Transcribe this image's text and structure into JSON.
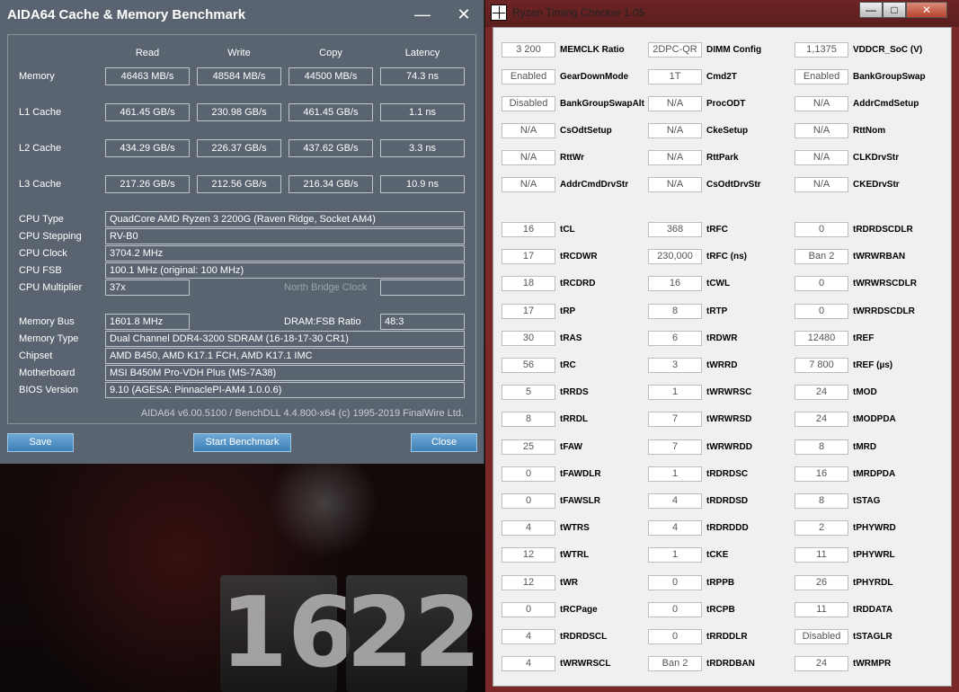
{
  "aida": {
    "title": "AIDA64 Cache & Memory Benchmark",
    "headers": [
      "Read",
      "Write",
      "Copy",
      "Latency"
    ],
    "rows": [
      {
        "label": "Memory",
        "values": [
          "46463 MB/s",
          "48584 MB/s",
          "44500 MB/s",
          "74.3 ns"
        ]
      },
      {
        "label": "L1 Cache",
        "values": [
          "461.45 GB/s",
          "230.98 GB/s",
          "461.45 GB/s",
          "1.1 ns"
        ]
      },
      {
        "label": "L2 Cache",
        "values": [
          "434.29 GB/s",
          "226.37 GB/s",
          "437.62 GB/s",
          "3.3 ns"
        ]
      },
      {
        "label": "L3 Cache",
        "values": [
          "217.26 GB/s",
          "212.56 GB/s",
          "216.34 GB/s",
          "10.9 ns"
        ]
      }
    ],
    "cpu_info": [
      {
        "label": "CPU Type",
        "value": "QuadCore AMD Ryzen 3 2200G  (Raven Ridge, Socket AM4)"
      },
      {
        "label": "CPU Stepping",
        "value": "RV-B0"
      },
      {
        "label": "CPU Clock",
        "value": "3704.2 MHz"
      },
      {
        "label": "CPU FSB",
        "value": "100.1 MHz  (original: 100 MHz)"
      }
    ],
    "cpu_multiplier": {
      "label": "CPU Multiplier",
      "value": "37x",
      "nb_label": "North Bridge Clock",
      "nb_value": ""
    },
    "memory_bus": {
      "label": "Memory Bus",
      "value": "1601.8 MHz",
      "ratio_label": "DRAM:FSB Ratio",
      "ratio_value": "48:3"
    },
    "sys_info": [
      {
        "label": "Memory Type",
        "value": "Dual Channel DDR4-3200 SDRAM  (16-18-17-30 CR1)"
      },
      {
        "label": "Chipset",
        "value": "AMD B450, AMD K17.1 FCH, AMD K17.1 IMC"
      },
      {
        "label": "Motherboard",
        "value": "MSI B450M Pro-VDH Plus (MS-7A38)"
      },
      {
        "label": "BIOS Version",
        "value": "9.10  (AGESA: PinnaclePI-AM4 1.0.0.6)"
      }
    ],
    "footer": "AIDA64 v6.00.5100 / BenchDLL 4.4.800-x64  (c) 1995-2019 FinalWire Ltd.",
    "buttons": {
      "save": "Save",
      "start": "Start Benchmark",
      "close": "Close"
    },
    "minimize_glyph": "—",
    "close_glyph": "✕"
  },
  "rtc": {
    "title": "Ryzen Timing Checker 1.05",
    "window_buttons": {
      "minimize": "—",
      "maximize": "□",
      "close": "✕"
    },
    "config": [
      [
        {
          "v": "3 200",
          "l": "MEMCLK Ratio"
        },
        {
          "v": "2DPC-QR",
          "l": "DIMM Config"
        },
        {
          "v": "1,1375",
          "l": "VDDCR_SoC (V)"
        }
      ],
      [
        {
          "v": "Enabled",
          "l": "GearDownMode"
        },
        {
          "v": "1T",
          "l": "Cmd2T"
        },
        {
          "v": "Enabled",
          "l": "BankGroupSwap"
        }
      ],
      [
        {
          "v": "Disabled",
          "l": "BankGroupSwapAlt"
        },
        {
          "v": "N/A",
          "l": "ProcODT"
        },
        {
          "v": "N/A",
          "l": "AddrCmdSetup"
        }
      ],
      [
        {
          "v": "N/A",
          "l": "CsOdtSetup"
        },
        {
          "v": "N/A",
          "l": "CkeSetup"
        },
        {
          "v": "N/A",
          "l": "RttNom"
        }
      ],
      [
        {
          "v": "N/A",
          "l": "RttWr"
        },
        {
          "v": "N/A",
          "l": "RttPark"
        },
        {
          "v": "N/A",
          "l": "CLKDrvStr"
        }
      ],
      [
        {
          "v": "N/A",
          "l": "AddrCmdDrvStr"
        },
        {
          "v": "N/A",
          "l": "CsOdtDrvStr"
        },
        {
          "v": "N/A",
          "l": "CKEDrvStr"
        }
      ]
    ],
    "timings": [
      [
        {
          "v": "16",
          "l": "tCL"
        },
        {
          "v": "368",
          "l": "tRFC"
        },
        {
          "v": "0",
          "l": "tRDRDSCDLR"
        }
      ],
      [
        {
          "v": "17",
          "l": "tRCDWR"
        },
        {
          "v": "230,000",
          "l": "tRFC (ns)"
        },
        {
          "v": "Ban 2",
          "l": "tWRWRBAN"
        }
      ],
      [
        {
          "v": "18",
          "l": "tRCDRD"
        },
        {
          "v": "16",
          "l": "tCWL"
        },
        {
          "v": "0",
          "l": "tWRWRSCDLR"
        }
      ],
      [
        {
          "v": "17",
          "l": "tRP"
        },
        {
          "v": "8",
          "l": "tRTP"
        },
        {
          "v": "0",
          "l": "tWRRDSCDLR"
        }
      ],
      [
        {
          "v": "30",
          "l": "tRAS"
        },
        {
          "v": "6",
          "l": "tRDWR"
        },
        {
          "v": "12480",
          "l": "tREF"
        }
      ],
      [
        {
          "v": "56",
          "l": "tRC"
        },
        {
          "v": "3",
          "l": "tWRRD"
        },
        {
          "v": "7 800",
          "l": "tREF (µs)"
        }
      ],
      [
        {
          "v": "5",
          "l": "tRRDS"
        },
        {
          "v": "1",
          "l": "tWRWRSC"
        },
        {
          "v": "24",
          "l": "tMOD"
        }
      ],
      [
        {
          "v": "8",
          "l": "tRRDL"
        },
        {
          "v": "7",
          "l": "tWRWRSD"
        },
        {
          "v": "24",
          "l": "tMODPDA"
        }
      ],
      [
        {
          "v": "25",
          "l": "tFAW"
        },
        {
          "v": "7",
          "l": "tWRWRDD"
        },
        {
          "v": "8",
          "l": "tMRD"
        }
      ],
      [
        {
          "v": "0",
          "l": "tFAWDLR"
        },
        {
          "v": "1",
          "l": "tRDRDSC"
        },
        {
          "v": "16",
          "l": "tMRDPDA"
        }
      ],
      [
        {
          "v": "0",
          "l": "tFAWSLR"
        },
        {
          "v": "4",
          "l": "tRDRDSD"
        },
        {
          "v": "8",
          "l": "tSTAG"
        }
      ],
      [
        {
          "v": "4",
          "l": "tWTRS"
        },
        {
          "v": "4",
          "l": "tRDRDDD"
        },
        {
          "v": "2",
          "l": "tPHYWRD"
        }
      ],
      [
        {
          "v": "12",
          "l": "tWTRL"
        },
        {
          "v": "1",
          "l": "tCKE"
        },
        {
          "v": "11",
          "l": "tPHYWRL"
        }
      ],
      [
        {
          "v": "12",
          "l": "tWR"
        },
        {
          "v": "0",
          "l": "tRPPB"
        },
        {
          "v": "26",
          "l": "tPHYRDL"
        }
      ],
      [
        {
          "v": "0",
          "l": "tRCPage"
        },
        {
          "v": "0",
          "l": "tRCPB"
        },
        {
          "v": "11",
          "l": "tRDDATA"
        }
      ],
      [
        {
          "v": "4",
          "l": "tRDRDSCL"
        },
        {
          "v": "0",
          "l": "tRRDDLR"
        },
        {
          "v": "Disabled",
          "l": "tSTAGLR"
        }
      ],
      [
        {
          "v": "4",
          "l": "tWRWRSCL"
        },
        {
          "v": "Ban 2",
          "l": "tRDRDBAN"
        },
        {
          "v": "24",
          "l": "tWRMPR"
        }
      ]
    ]
  },
  "clock": {
    "hours": "16",
    "minutes": "22"
  }
}
